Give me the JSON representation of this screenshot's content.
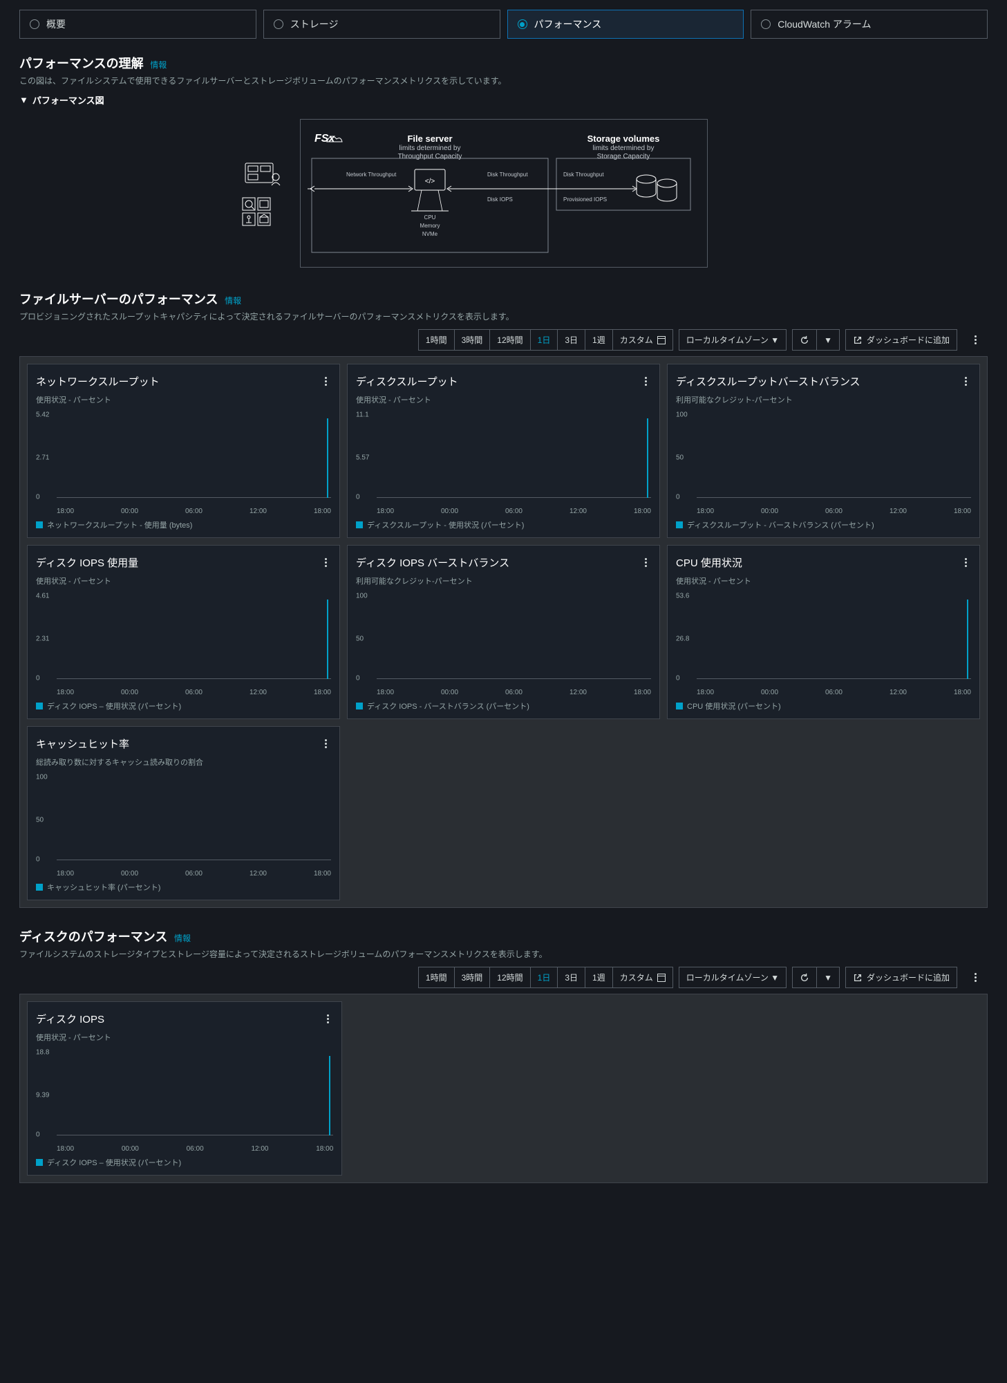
{
  "tabs": [
    {
      "label": "概要"
    },
    {
      "label": "ストレージ"
    },
    {
      "label": "パフォーマンス"
    },
    {
      "label": "CloudWatch アラーム"
    }
  ],
  "understanding": {
    "title": "パフォーマンスの理解",
    "info": "情報",
    "desc": "この図は、ファイルシステムで使用できるファイルサーバーとストレージボリュームのパフォーマンスメトリクスを示しています。",
    "expander": "パフォーマンス図",
    "diagram": {
      "logo": "FSx",
      "file_server_title": "File server",
      "file_server_sub1": "limits determined by",
      "file_server_sub2": "Throughput Capacity",
      "storage_title": "Storage volumes",
      "storage_sub1": "limits determined by",
      "storage_sub2": "Storage Capacity",
      "net_tp": "Network Throughput",
      "disk_tp": "Disk Throughput",
      "disk_iops": "Disk IOPS",
      "disk_tp2": "Disk Throughput",
      "prov_iops": "Provisioned IOPS",
      "cpu": "CPU",
      "memory": "Memory",
      "nvme": "NVMe"
    }
  },
  "file_server": {
    "title": "ファイルサーバーのパフォーマンス",
    "info": "情報",
    "desc": "プロビジョニングされたスループットキャパシティによって決定されるファイルサーバーのパフォーマンスメトリクスを表示します。"
  },
  "disk_perf": {
    "title": "ディスクのパフォーマンス",
    "info": "情報",
    "desc": "ファイルシステムのストレージタイプとストレージ容量によって決定されるストレージボリュームのパフォーマンスメトリクスを表示します。"
  },
  "toolbar": {
    "ranges": [
      "1時間",
      "3時間",
      "12時間",
      "1日",
      "3日",
      "1週",
      "カスタム"
    ],
    "active_range": "1日",
    "timezone": "ローカルタイムゾーン ▼",
    "add_dash": "ダッシュボードに追加"
  },
  "xticks": [
    "18:00",
    "00:00",
    "06:00",
    "12:00",
    "18:00"
  ],
  "charts_fs": [
    {
      "title": "ネットワークスループット",
      "sub": "使用状況 - パーセント",
      "ymax": "5.42",
      "ymid": "2.71",
      "legend": "ネットワークスループット - 使用量 (bytes)",
      "spike": true
    },
    {
      "title": "ディスクスループット",
      "sub": "使用状況 - パーセント",
      "ymax": "11.1",
      "ymid": "5.57",
      "legend": "ディスクスループット - 使用状況 (パーセント)",
      "spike": true
    },
    {
      "title": "ディスクスループットバーストバランス",
      "sub": "利用可能なクレジット-パーセント",
      "ymax": "100",
      "ymid": "50",
      "legend": "ディスクスループット - バーストバランス (パーセント)",
      "spike": false
    },
    {
      "title": "ディスク IOPS 使用量",
      "sub": "使用状況 - パーセント",
      "ymax": "4.61",
      "ymid": "2.31",
      "legend": "ディスク IOPS – 使用状況 (パーセント)",
      "spike": true
    },
    {
      "title": "ディスク IOPS バーストバランス",
      "sub": "利用可能なクレジット-パーセント",
      "ymax": "100",
      "ymid": "50",
      "legend": "ディスク IOPS - バーストバランス (パーセント)",
      "spike": false
    },
    {
      "title": "CPU 使用状況",
      "sub": "使用状況 - パーセント",
      "ymax": "53.6",
      "ymid": "26.8",
      "legend": "CPU 使用状況 (パーセント)",
      "spike": true
    },
    {
      "title": "キャッシュヒット率",
      "sub": "総読み取り数に対するキャッシュ読み取りの割合",
      "ymax": "100",
      "ymid": "50",
      "legend": "キャッシュヒット率 (パーセント)",
      "spike": false
    }
  ],
  "charts_disk": [
    {
      "title": "ディスク IOPS",
      "sub": "使用状況 - パーセント",
      "ymax": "18.8",
      "ymid": "9.39",
      "legend": "ディスク IOPS – 使用状況 (パーセント)",
      "spike": true
    }
  ],
  "chart_data": [
    {
      "type": "line",
      "title": "ネットワークスループット",
      "ylabel": "パーセント",
      "ylim": [
        0,
        5.42
      ],
      "categories": [
        "18:00",
        "00:00",
        "06:00",
        "12:00",
        "18:00"
      ],
      "series": [
        {
          "name": "ネットワークスループット - 使用量 (bytes)",
          "values": [
            0,
            0,
            0,
            0,
            5.42
          ]
        }
      ]
    },
    {
      "type": "line",
      "title": "ディスクスループット",
      "ylabel": "パーセント",
      "ylim": [
        0,
        11.1
      ],
      "categories": [
        "18:00",
        "00:00",
        "06:00",
        "12:00",
        "18:00"
      ],
      "series": [
        {
          "name": "ディスクスループット - 使用状況 (パーセント)",
          "values": [
            0,
            0,
            0,
            0,
            11.1
          ]
        }
      ]
    },
    {
      "type": "line",
      "title": "ディスクスループットバーストバランス",
      "ylabel": "パーセント",
      "ylim": [
        0,
        100
      ],
      "categories": [
        "18:00",
        "00:00",
        "06:00",
        "12:00",
        "18:00"
      ],
      "series": [
        {
          "name": "ディスクスループット - バーストバランス (パーセント)",
          "values": [
            null,
            null,
            null,
            null,
            null
          ]
        }
      ]
    },
    {
      "type": "line",
      "title": "ディスク IOPS 使用量",
      "ylabel": "パーセント",
      "ylim": [
        0,
        4.61
      ],
      "categories": [
        "18:00",
        "00:00",
        "06:00",
        "12:00",
        "18:00"
      ],
      "series": [
        {
          "name": "ディスク IOPS – 使用状況 (パーセント)",
          "values": [
            0,
            0,
            0,
            0,
            4.61
          ]
        }
      ]
    },
    {
      "type": "line",
      "title": "ディスク IOPS バーストバランス",
      "ylabel": "パーセント",
      "ylim": [
        0,
        100
      ],
      "categories": [
        "18:00",
        "00:00",
        "06:00",
        "12:00",
        "18:00"
      ],
      "series": [
        {
          "name": "ディスク IOPS - バーストバランス (パーセント)",
          "values": [
            null,
            null,
            null,
            null,
            null
          ]
        }
      ]
    },
    {
      "type": "line",
      "title": "CPU 使用状況",
      "ylabel": "パーセント",
      "ylim": [
        0,
        53.6
      ],
      "categories": [
        "18:00",
        "00:00",
        "06:00",
        "12:00",
        "18:00"
      ],
      "series": [
        {
          "name": "CPU 使用状況 (パーセント)",
          "values": [
            0,
            0,
            0,
            0,
            53.6
          ]
        }
      ]
    },
    {
      "type": "line",
      "title": "キャッシュヒット率",
      "ylabel": "パーセント",
      "ylim": [
        0,
        100
      ],
      "categories": [
        "18:00",
        "00:00",
        "06:00",
        "12:00",
        "18:00"
      ],
      "series": [
        {
          "name": "キャッシュヒット率 (パーセント)",
          "values": [
            null,
            null,
            null,
            null,
            null
          ]
        }
      ]
    },
    {
      "type": "line",
      "title": "ディスク IOPS",
      "ylabel": "パーセント",
      "ylim": [
        0,
        18.8
      ],
      "categories": [
        "18:00",
        "00:00",
        "06:00",
        "12:00",
        "18:00"
      ],
      "series": [
        {
          "name": "ディスク IOPS – 使用状況 (パーセント)",
          "values": [
            0,
            0,
            0,
            0,
            18.8
          ]
        }
      ]
    }
  ]
}
